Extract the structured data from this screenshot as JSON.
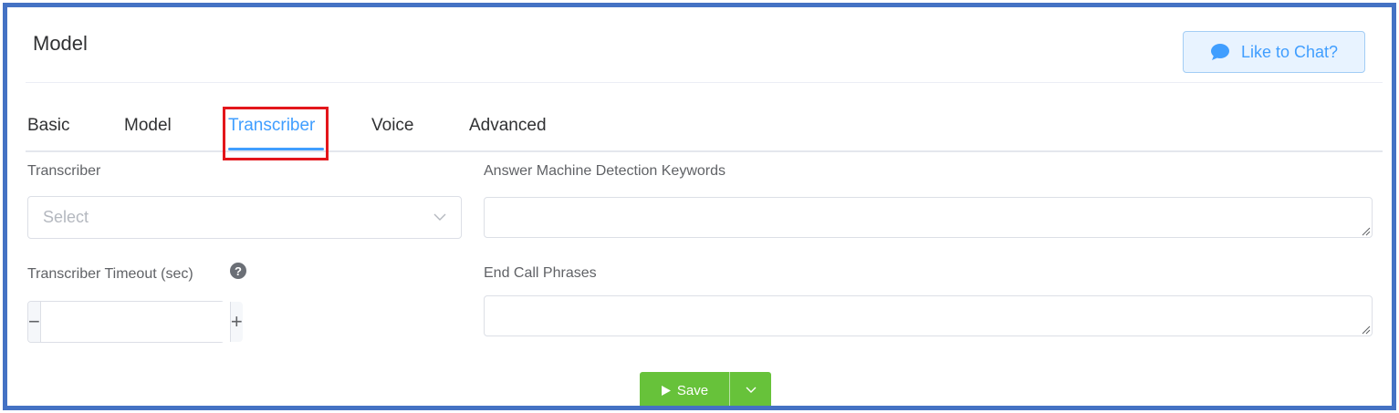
{
  "header": {
    "title": "Model",
    "chat_button": {
      "label": "Like to Chat?",
      "icon": "chat-bubble-icon"
    }
  },
  "tabs": [
    {
      "label": "Basic",
      "active": false
    },
    {
      "label": "Model",
      "active": false
    },
    {
      "label": "Transcriber",
      "active": true
    },
    {
      "label": "Voice",
      "active": false
    },
    {
      "label": "Advanced",
      "active": false
    }
  ],
  "form": {
    "transcriber": {
      "label": "Transcriber",
      "placeholder": "Select",
      "value": ""
    },
    "timeout": {
      "label": "Transcriber Timeout (sec)",
      "help_icon": "question-circle-icon",
      "value": ""
    },
    "amd_keywords": {
      "label": "Answer Machine Detection Keywords",
      "value": ""
    },
    "end_call_phrases": {
      "label": "End Call Phrases",
      "value": ""
    }
  },
  "actions": {
    "save_label": "Save"
  },
  "colors": {
    "accent": "#409eff",
    "save_green": "#67c23a",
    "frame_border": "#4472c4",
    "highlight": "#e3161b"
  }
}
